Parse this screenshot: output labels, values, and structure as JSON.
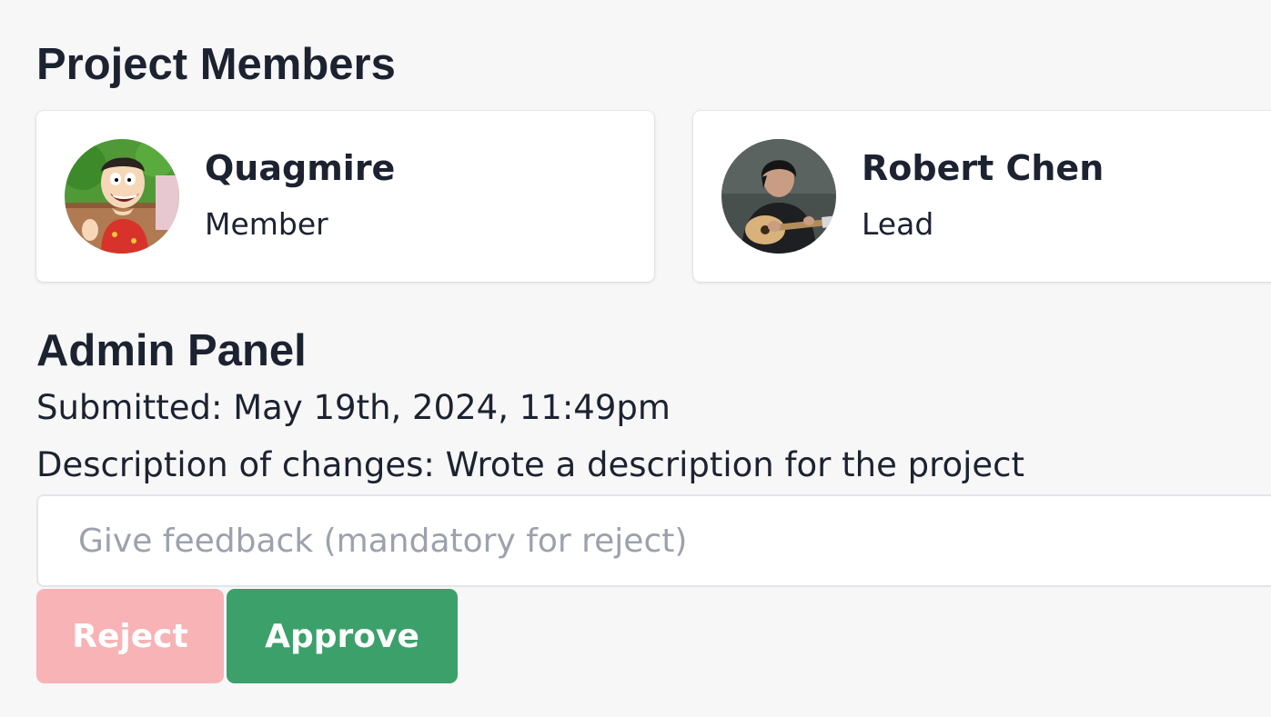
{
  "members_section": {
    "title": "Project Members",
    "members": [
      {
        "name": "Quagmire",
        "role": "Member",
        "avatar": "cartoon-avatar"
      },
      {
        "name": "Robert Chen",
        "role": "Lead",
        "avatar": "guitar-player-photo"
      }
    ]
  },
  "admin_panel": {
    "title": "Admin Panel",
    "submitted": "Submitted: May 19th, 2024, 11:49pm",
    "description": "Description of changes: Wrote a description for the project",
    "feedback": {
      "value": "",
      "placeholder": "Give feedback (mandatory for reject)"
    },
    "reject_label": "Reject",
    "approve_label": "Approve"
  },
  "colors": {
    "reject_disabled": "#f7b3b5",
    "approve": "#3ca06a",
    "text": "#1c2230",
    "background": "#f7f7f8"
  }
}
